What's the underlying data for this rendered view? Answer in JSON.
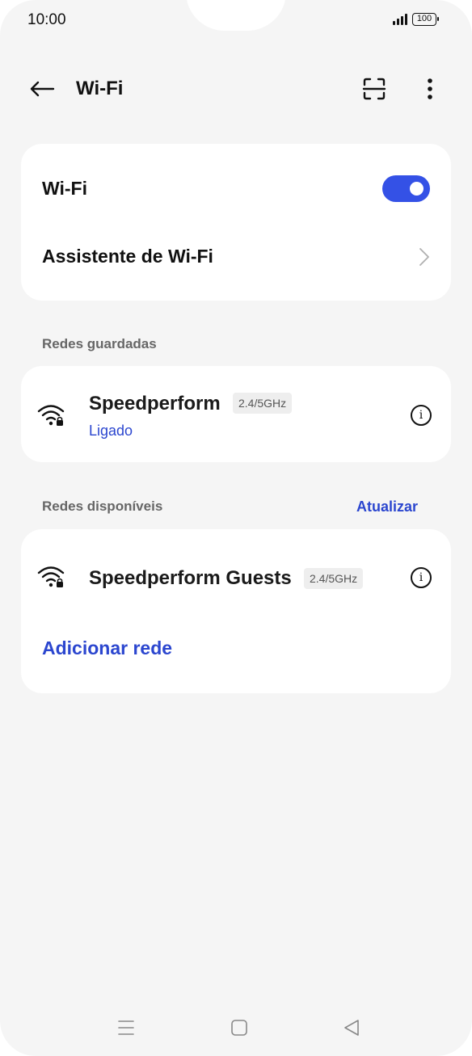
{
  "status_bar": {
    "time": "10:00",
    "battery": "100"
  },
  "header": {
    "title": "Wi-Fi",
    "back_icon": "arrow-left-icon",
    "scan_icon": "qr-scan-icon",
    "more_icon": "more-vertical-icon"
  },
  "settings": {
    "wifi_label": "Wi-Fi",
    "wifi_enabled": true,
    "assistant_label": "Assistente de Wi-Fi"
  },
  "saved": {
    "title": "Redes guardadas",
    "networks": [
      {
        "name": "Speedperform",
        "band": "2.4/5GHz",
        "status": "Ligado",
        "secured": true
      }
    ]
  },
  "available": {
    "title": "Redes disponíveis",
    "refresh_label": "Atualizar",
    "networks": [
      {
        "name": "Speedperform Guests",
        "band": "2.4/5GHz",
        "secured": true
      }
    ],
    "add_label": "Adicionar rede"
  },
  "colors": {
    "accent": "#3451e6",
    "link": "#2b46cf",
    "background": "#f5f5f5",
    "card": "#ffffff"
  },
  "nav_bar": {
    "menu_icon": "menu-icon",
    "home_icon": "home-square-icon",
    "back_icon": "back-triangle-icon"
  }
}
